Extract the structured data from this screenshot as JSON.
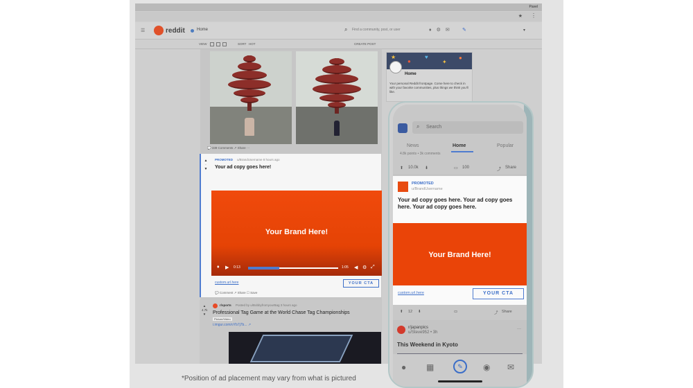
{
  "browser": {
    "top_tag": "Pavel",
    "close_glyph": "×",
    "star_glyph": "★",
    "menu_glyph": "⋮"
  },
  "header": {
    "logo_text": "reddit",
    "home_label": "Home",
    "search_placeholder": "Find a community, post, or user",
    "hamburger_glyph": "☰"
  },
  "subbar": {
    "view_label": "VIEW",
    "sort_label": "SORT",
    "sort_value": "HOT",
    "create_post": "CREATE POST"
  },
  "feed": {
    "post1_actions": "💬 339 Comments    ↗ Share    ···",
    "ad": {
      "votes": "Vote",
      "promoted": "PROMOTED",
      "byline": "u/BrandUsername 8 hours ago",
      "copy": "Your ad copy goes here!",
      "brand": "Your Brand Here!",
      "time_current": "0:13",
      "time_total": "1:05",
      "url": "custom.url.here",
      "cta": "YOUR CTA",
      "actions": "💬 Comment    ↗ Share    ☐ Save"
    },
    "post2": {
      "votes": "4.7k",
      "subreddit": "r/sports",
      "meta": "Posted by u/BobbyfromyourBag 3 hours ago",
      "title": "Professional Tag Game at the World Chase Tag Championships",
      "flair": "Picture/Video",
      "link": "i.imgur.com/oYb7j7b... ↗"
    }
  },
  "sidebar": {
    "title": "Home",
    "description": "Your personal Reddit frontpage. Come here to check in with your favorite communities, plus things we think you'll like."
  },
  "phone": {
    "search_placeholder": "Search",
    "tabs": [
      "News",
      "Home",
      "Popular"
    ],
    "cut_text": "4.8k points • 3k comments",
    "stats": {
      "up": "10.0k",
      "comments": "100",
      "share": "Share"
    },
    "ad": {
      "promoted": "PROMOTED",
      "username": "u/BrandUsername",
      "copy": "Your ad copy goes here. Your ad copy goes here. Your ad copy goes here.",
      "brand": "Your Brand Here!",
      "url": "custom.url.here",
      "cta": "YOUR CTA"
    },
    "ad_actions": {
      "votes": "12",
      "comments": "",
      "share": "Share"
    },
    "post": {
      "subreddit": "r/japanpics",
      "byline": "u/Steve952 • 3h",
      "title": "This Weekend in Kyoto"
    }
  },
  "footnote": "*Position of ad placement may vary from what is pictured",
  "colors": {
    "brand_orange": "#ea4408",
    "link_blue": "#3b6ec8"
  }
}
